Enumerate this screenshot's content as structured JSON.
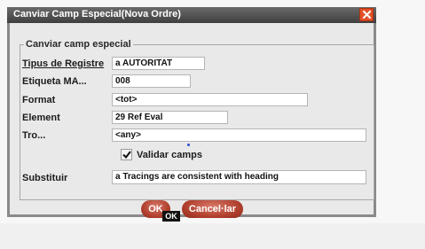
{
  "dialog": {
    "title": "Canviar Camp Especial(Nova Ordre)",
    "group_title": "Canviar camp especial"
  },
  "fields": {
    "tipus_label": "Tipus de Registre",
    "tipus_value": "a  AUTORITAT",
    "etiqueta_label": "Etiqueta MA...",
    "etiqueta_value": "008",
    "format_label": "Format",
    "format_value": "<tot>",
    "element_label": "Element",
    "element_value": "29  Ref Eval",
    "tro_label": "Tro...",
    "tro_value": "<any>",
    "validar_label": "Validar camps",
    "validar_checked": true,
    "substituir_label": "Substituir",
    "substituir_value": "a Tracings are consistent with heading"
  },
  "buttons": {
    "ok_label": "OK",
    "cancel_label": "Cancel·lar"
  },
  "tooltip": {
    "text": "OK"
  },
  "colors": {
    "title_bar": "#4a4a4a",
    "close_button": "#e2522a",
    "button": "#b2412f"
  },
  "icons": {
    "close": "close-icon",
    "check": "check-icon"
  }
}
